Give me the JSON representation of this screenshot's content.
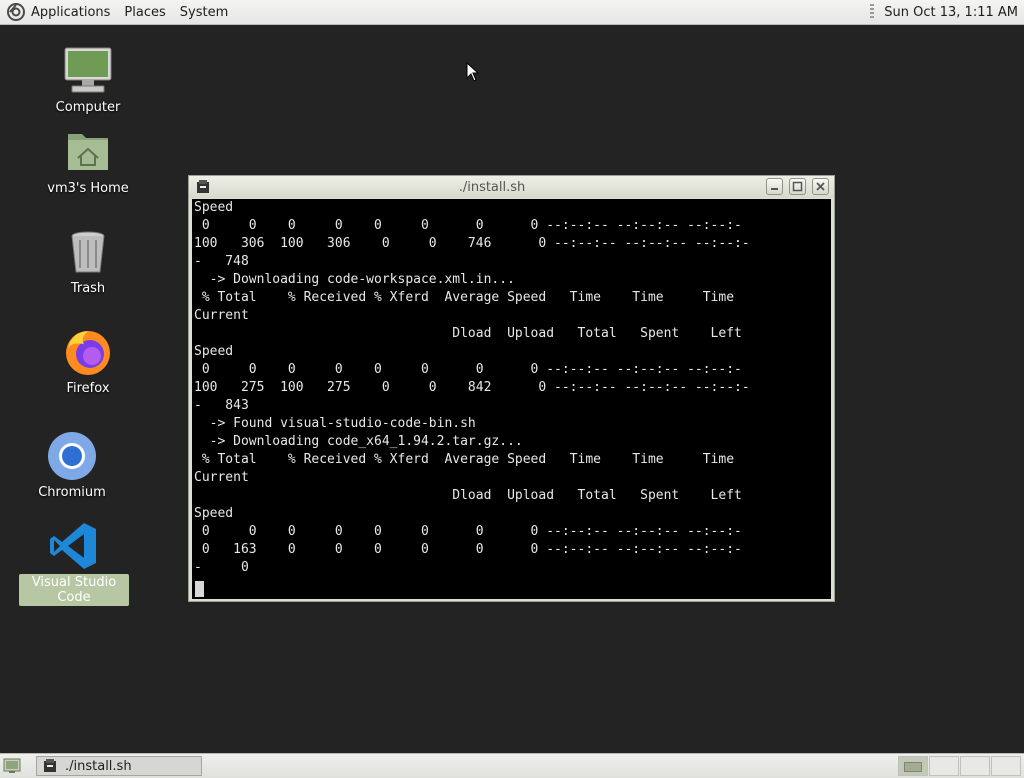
{
  "top_panel": {
    "menus": [
      "Applications",
      "Places",
      "System"
    ],
    "clock": "Sun Oct 13,  1:11 AM"
  },
  "desktop_icons": [
    {
      "label": "Computer",
      "icon": "computer-icon"
    },
    {
      "label": "vm3's Home",
      "icon": "home-folder-icon"
    },
    {
      "label": "Trash",
      "icon": "trash-icon"
    },
    {
      "label": "Firefox",
      "icon": "firefox-icon"
    },
    {
      "label": "Chromium",
      "icon": "chromium-icon"
    },
    {
      "label": "Visual Studio Code",
      "icon": "vscode-icon",
      "selected": true
    }
  ],
  "window": {
    "title": "./install.sh",
    "lines": [
      "Speed",
      " 0     0    0     0    0     0      0      0 --:--:-- --:--:-- --:--:-",
      "100   306  100   306    0     0    746      0 --:--:-- --:--:-- --:--:-",
      "-   748",
      "  -> Downloading code-workspace.xml.in...",
      " % Total    % Received % Xferd  Average Speed   Time    Time     Time",
      "Current",
      "                                 Dload  Upload   Total   Spent    Left",
      "Speed",
      " 0     0    0     0    0     0      0      0 --:--:-- --:--:-- --:--:-",
      "100   275  100   275    0     0    842      0 --:--:-- --:--:-- --:--:-",
      "-   843",
      "  -> Found visual-studio-code-bin.sh",
      "  -> Downloading code_x64_1.94.2.tar.gz...",
      " % Total    % Received % Xferd  Average Speed   Time    Time     Time",
      "Current",
      "                                 Dload  Upload   Total   Spent    Left",
      "Speed",
      " 0     0    0     0    0     0      0      0 --:--:-- --:--:-- --:--:-",
      " 0   163    0     0    0     0      0      0 --:--:-- --:--:-- --:--:-",
      "-     0"
    ]
  },
  "taskbar": {
    "task_label": "./install.sh"
  },
  "colors": {
    "desktop_bg": "#232323",
    "terminal_bg": "#000000",
    "terminal_fg": "#e8e8e8",
    "selection": "#b7c7a4"
  }
}
